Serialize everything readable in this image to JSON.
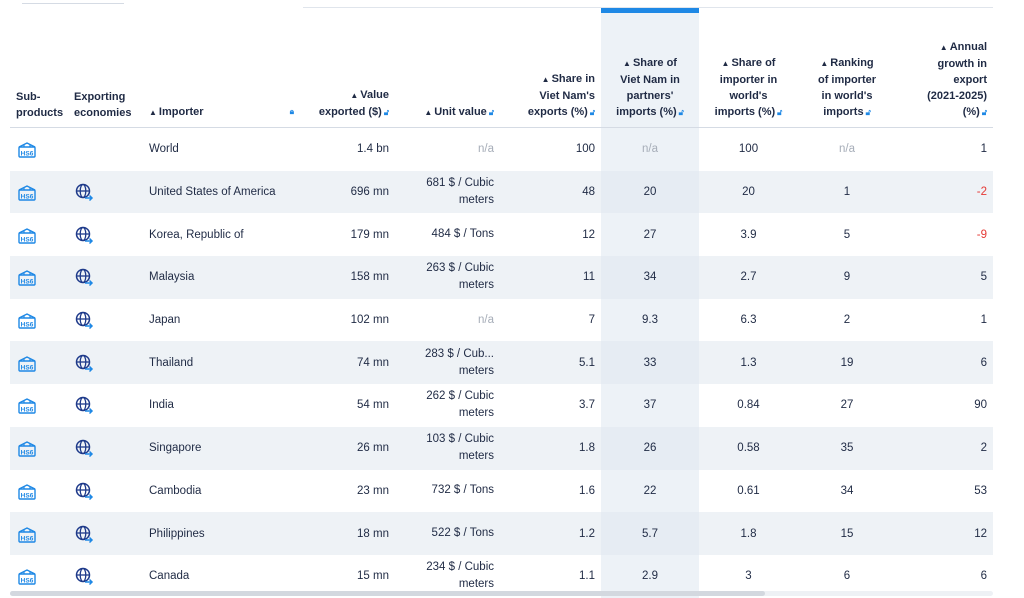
{
  "headers": {
    "subproducts": [
      "Sub-",
      "products"
    ],
    "exporting": [
      "Exporting",
      "economies"
    ],
    "importer": "Importer",
    "value": [
      "Value",
      "exported ($)"
    ],
    "unit_value": "Unit value",
    "share_vn": [
      "Share in",
      "Viet Nam's",
      "exports (%)"
    ],
    "share_partner": [
      "Share of",
      "Viet Nam in",
      "partners'",
      "imports (%)"
    ],
    "share_world": [
      "Share of",
      "importer in",
      "world's",
      "imports (%)"
    ],
    "ranking": [
      "Ranking",
      "of importer",
      "in world's",
      "imports"
    ],
    "growth": [
      "Annual",
      "growth in",
      "export",
      "(2021-2025)",
      "(%)"
    ]
  },
  "rows": [
    {
      "importer": "World",
      "value": "1.4 bn",
      "unit": [
        "n/a"
      ],
      "share_vn": "100",
      "share_partner": "n/a",
      "share_world": "100",
      "ranking": "n/a",
      "growth": "1"
    },
    {
      "importer": "United States of America",
      "value": "696 mn",
      "unit": [
        "681 $ / Cubic",
        "meters"
      ],
      "share_vn": "48",
      "share_partner": "20",
      "share_world": "20",
      "ranking": "1",
      "growth": "-2"
    },
    {
      "importer": "Korea, Republic of",
      "value": "179 mn",
      "unit": [
        "484 $ / Tons"
      ],
      "share_vn": "12",
      "share_partner": "27",
      "share_world": "3.9",
      "ranking": "5",
      "growth": "-9"
    },
    {
      "importer": "Malaysia",
      "value": "158 mn",
      "unit": [
        "263 $ / Cubic",
        "meters"
      ],
      "share_vn": "11",
      "share_partner": "34",
      "share_world": "2.7",
      "ranking": "9",
      "growth": "5"
    },
    {
      "importer": "Japan",
      "value": "102 mn",
      "unit": [
        "n/a"
      ],
      "share_vn": "7",
      "share_partner": "9.3",
      "share_world": "6.3",
      "ranking": "2",
      "growth": "1"
    },
    {
      "importer": "Thailand",
      "value": "74 mn",
      "unit": [
        "283 $ / Cub...",
        "meters"
      ],
      "share_vn": "5.1",
      "share_partner": "33",
      "share_world": "1.3",
      "ranking": "19",
      "growth": "6"
    },
    {
      "importer": "India",
      "value": "54 mn",
      "unit": [
        "262 $ / Cubic",
        "meters"
      ],
      "share_vn": "3.7",
      "share_partner": "37",
      "share_world": "0.84",
      "ranking": "27",
      "growth": "90"
    },
    {
      "importer": "Singapore",
      "value": "26 mn",
      "unit": [
        "103 $ / Cubic",
        "meters"
      ],
      "share_vn": "1.8",
      "share_partner": "26",
      "share_world": "0.58",
      "ranking": "35",
      "growth": "2"
    },
    {
      "importer": "Cambodia",
      "value": "23 mn",
      "unit": [
        "732 $ / Tons"
      ],
      "share_vn": "1.6",
      "share_partner": "22",
      "share_world": "0.61",
      "ranking": "34",
      "growth": "53"
    },
    {
      "importer": "Philippines",
      "value": "18 mn",
      "unit": [
        "522 $ / Tons"
      ],
      "share_vn": "1.2",
      "share_partner": "5.7",
      "share_world": "1.8",
      "ranking": "15",
      "growth": "12"
    },
    {
      "importer": "Canada",
      "value": "15 mn",
      "unit": [
        "234 $ / Cubic",
        "meters"
      ],
      "share_vn": "1.1",
      "share_partner": "2.9",
      "share_world": "3",
      "ranking": "6",
      "growth": "6"
    }
  ],
  "icons": {
    "subproduct": "hs6-box-icon",
    "exporting": "globe-arrow-icon",
    "sort": "sort-icon",
    "lock": "lock-icon"
  },
  "colors": {
    "accent": "#1e88e5",
    "negative": "#e53935",
    "selected_column": "#edf2f7"
  }
}
